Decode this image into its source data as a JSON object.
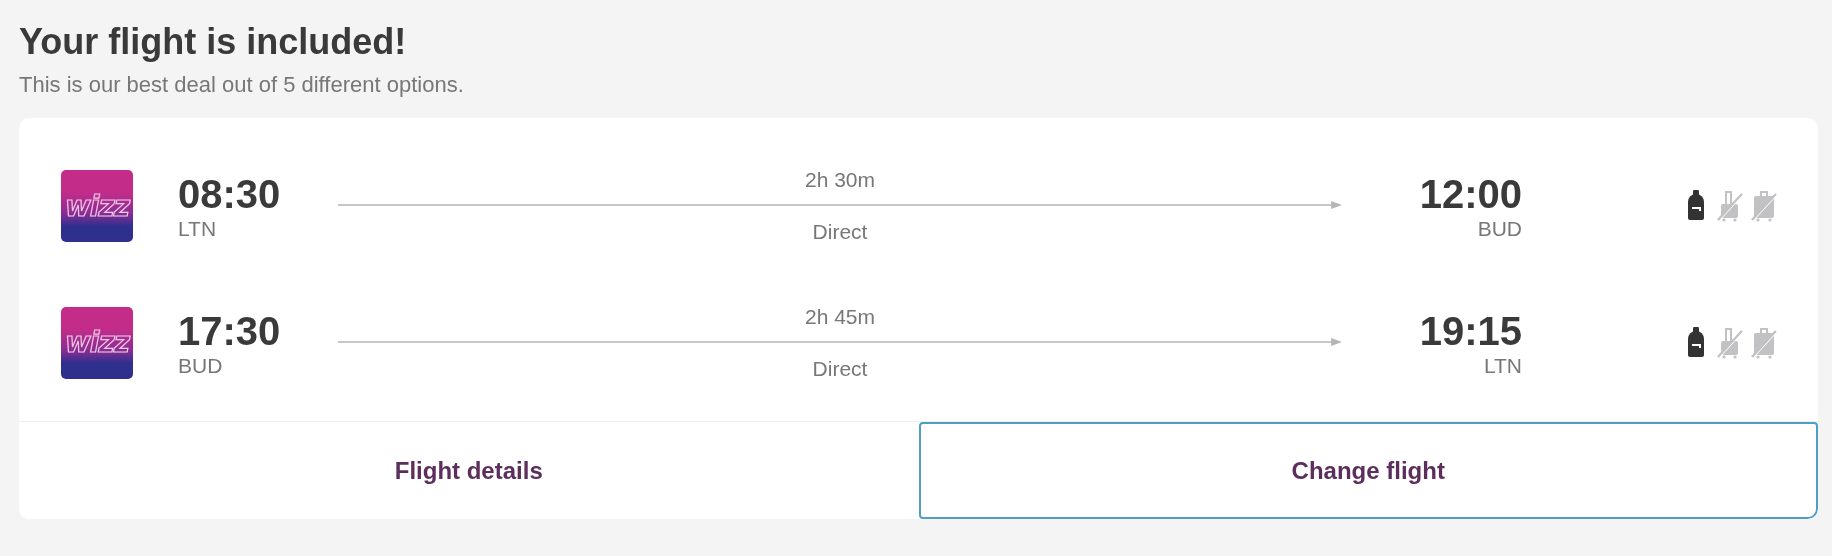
{
  "header": {
    "title": "Your flight is included!",
    "subtitle": "This is our best deal out of 5 different options."
  },
  "flights": [
    {
      "logo_text": "wizz",
      "departure_time": "08:30",
      "departure_airport": "LTN",
      "duration": "2h 30m",
      "stops": "Direct",
      "arrival_time": "12:00",
      "arrival_airport": "BUD",
      "bags": [
        {
          "kind": "backpack",
          "included": true
        },
        {
          "kind": "cabin",
          "included": false
        },
        {
          "kind": "checked",
          "included": false
        }
      ]
    },
    {
      "logo_text": "wizz",
      "departure_time": "17:30",
      "departure_airport": "BUD",
      "duration": "2h 45m",
      "stops": "Direct",
      "arrival_time": "19:15",
      "arrival_airport": "LTN",
      "bags": [
        {
          "kind": "backpack",
          "included": true
        },
        {
          "kind": "cabin",
          "included": false
        },
        {
          "kind": "checked",
          "included": false
        }
      ]
    }
  ],
  "buttons": [
    {
      "label": "Flight details",
      "selected": false
    },
    {
      "label": "Change flight",
      "selected": true
    }
  ]
}
